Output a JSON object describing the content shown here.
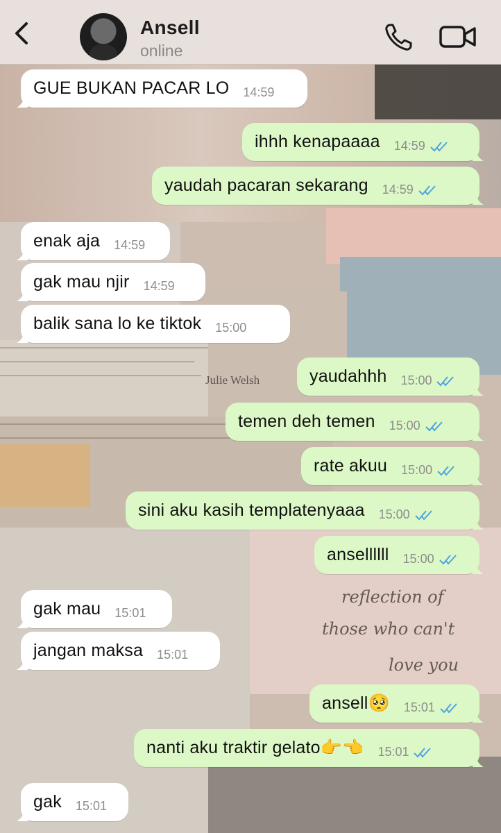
{
  "header": {
    "contact_name": "Ansell",
    "status": "online",
    "back_icon": "chevron-left-icon",
    "call_icon": "phone-icon",
    "video_icon": "video-camera-icon"
  },
  "colors": {
    "incoming_bubble": "#ffffff",
    "outgoing_bubble": "#dcf8c6",
    "read_ticks": "#4fa3e0",
    "header_bg": "#e8e0dc"
  },
  "wallpaper": {
    "ink_text": [
      "Julie Welsh",
      "reflection of",
      "those who can't",
      "love you"
    ]
  },
  "messages": [
    {
      "dir": "in",
      "text": "GUE BUKAN PACAR LO",
      "time": "14:59"
    },
    {
      "dir": "out",
      "text": "ihhh kenapaaaa",
      "time": "14:59",
      "read": true
    },
    {
      "dir": "out",
      "text": "yaudah pacaran sekarang",
      "time": "14:59",
      "read": true
    },
    {
      "dir": "in",
      "text": "enak aja",
      "time": "14:59"
    },
    {
      "dir": "in",
      "text": "gak mau njir",
      "time": "14:59"
    },
    {
      "dir": "in",
      "text": "balik sana lo ke tiktok",
      "time": "15:00"
    },
    {
      "dir": "out",
      "text": "yaudahhh",
      "time": "15:00",
      "read": true
    },
    {
      "dir": "out",
      "text": "temen deh temen",
      "time": "15:00",
      "read": true
    },
    {
      "dir": "out",
      "text": "rate akuu",
      "time": "15:00",
      "read": true
    },
    {
      "dir": "out",
      "text": "sini aku kasih templatenyaaa",
      "time": "15:00",
      "read": true
    },
    {
      "dir": "out",
      "text": "ansellllll",
      "time": "15:00",
      "read": true
    },
    {
      "dir": "in",
      "text": "gak mau",
      "time": "15:01"
    },
    {
      "dir": "in",
      "text": "jangan maksa",
      "time": "15:01"
    },
    {
      "dir": "out",
      "text": "ansell🥺",
      "time": "15:01",
      "read": true
    },
    {
      "dir": "out",
      "text": "nanti aku traktir gelato👉👈",
      "time": "15:01",
      "read": true
    },
    {
      "dir": "in",
      "text": "gak",
      "time": "15:01"
    }
  ]
}
